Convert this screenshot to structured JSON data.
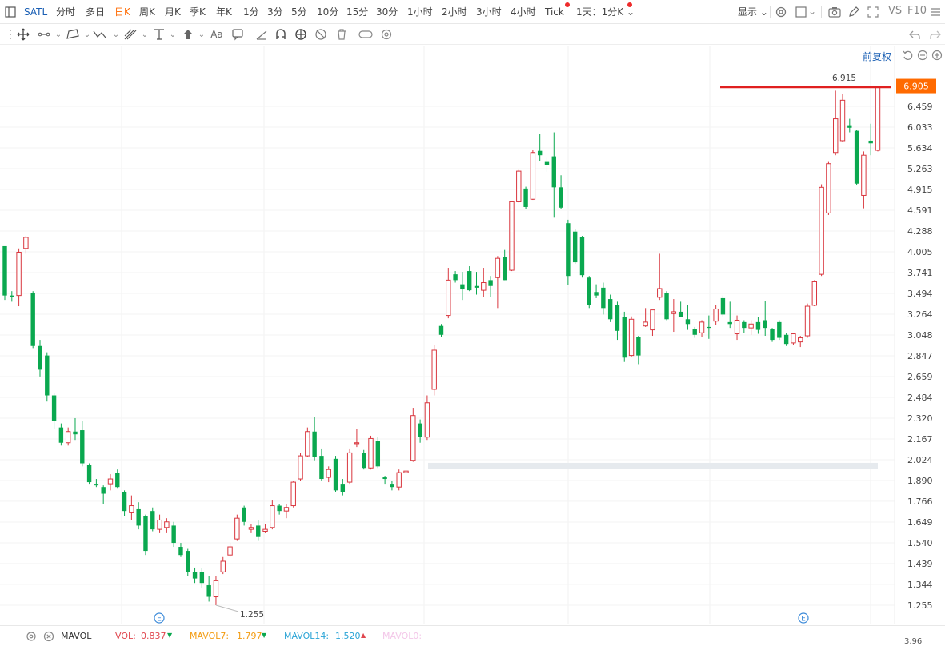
{
  "toolbar": {
    "symbol": "SATL",
    "periods": [
      "分时",
      "多日",
      "日K",
      "周K",
      "月K",
      "季K",
      "年K",
      "1分",
      "3分",
      "5分",
      "10分",
      "15分",
      "30分",
      "1小时",
      "2小时",
      "3小时",
      "4小时",
      "Tick"
    ],
    "active_period": "日K",
    "interval_selector": "1天：1分K",
    "display_label": "显示",
    "vs_label": "VS",
    "f10_label": "F10"
  },
  "chart_header": {
    "adjust_label": "前复权"
  },
  "price_axis": {
    "current_price": "6.905",
    "labels": [
      "6.459",
      "6.033",
      "5.634",
      "5.263",
      "4.915",
      "4.591",
      "4.288",
      "4.005",
      "3.741",
      "3.494",
      "3.264",
      "3.048",
      "2.847",
      "2.659",
      "2.484",
      "2.320",
      "2.167",
      "2.024",
      "1.890",
      "1.766",
      "1.649",
      "1.540",
      "1.439",
      "1.344",
      "1.255"
    ]
  },
  "annotations": {
    "high_label": "6.915",
    "low_label": "1.255",
    "event_marker": "E"
  },
  "indicator": {
    "name": "MAVOL",
    "vol_label": "VOL:",
    "vol_value": "0.837",
    "mavol7_label": "MAVOL7:",
    "mavol7_value": "1.797",
    "mavol14_label": "MAVOL14:",
    "mavol14_value": "1.520",
    "mavol0_label": "MAVOL0:",
    "axis_value": "3.96"
  },
  "colors": {
    "up": "#d9363e",
    "down": "#0aa84f",
    "accent": "#ff6a00",
    "link": "#1a5fb4"
  },
  "chart_data": {
    "type": "candlestick",
    "ylim": [
      1.255,
      6.915
    ],
    "y_scale": "log",
    "candles": [
      {
        "o": 4.08,
        "h": 4.08,
        "l": 3.42,
        "c": 3.47
      },
      {
        "o": 3.47,
        "h": 3.52,
        "l": 3.4,
        "c": 3.45
      },
      {
        "o": 3.47,
        "h": 4.05,
        "l": 3.35,
        "c": 4.0
      },
      {
        "o": 4.05,
        "h": 4.22,
        "l": 3.98,
        "c": 4.2
      },
      {
        "o": 3.5,
        "h": 3.52,
        "l": 2.92,
        "c": 2.94
      },
      {
        "o": 2.94,
        "h": 3.0,
        "l": 2.66,
        "c": 2.72
      },
      {
        "o": 2.85,
        "h": 2.88,
        "l": 2.45,
        "c": 2.5
      },
      {
        "o": 2.5,
        "h": 2.52,
        "l": 2.24,
        "c": 2.3
      },
      {
        "o": 2.25,
        "h": 2.28,
        "l": 2.12,
        "c": 2.14
      },
      {
        "o": 2.14,
        "h": 2.25,
        "l": 2.12,
        "c": 2.22
      },
      {
        "o": 2.22,
        "h": 2.32,
        "l": 2.16,
        "c": 2.2
      },
      {
        "o": 2.23,
        "h": 2.3,
        "l": 1.98,
        "c": 2.0
      },
      {
        "o": 1.99,
        "h": 2.0,
        "l": 1.87,
        "c": 1.88
      },
      {
        "o": 1.87,
        "h": 1.9,
        "l": 1.85,
        "c": 1.86
      },
      {
        "o": 1.85,
        "h": 1.86,
        "l": 1.75,
        "c": 1.81
      },
      {
        "o": 1.87,
        "h": 1.93,
        "l": 1.83,
        "c": 1.9
      },
      {
        "o": 1.94,
        "h": 1.96,
        "l": 1.84,
        "c": 1.85
      },
      {
        "o": 1.82,
        "h": 1.83,
        "l": 1.68,
        "c": 1.71
      },
      {
        "o": 1.7,
        "h": 1.8,
        "l": 1.66,
        "c": 1.74
      },
      {
        "o": 1.72,
        "h": 1.76,
        "l": 1.61,
        "c": 1.63
      },
      {
        "o": 1.68,
        "h": 1.69,
        "l": 1.48,
        "c": 1.5
      },
      {
        "o": 1.71,
        "h": 1.73,
        "l": 1.6,
        "c": 1.61
      },
      {
        "o": 1.61,
        "h": 1.69,
        "l": 1.59,
        "c": 1.66
      },
      {
        "o": 1.62,
        "h": 1.67,
        "l": 1.59,
        "c": 1.65
      },
      {
        "o": 1.63,
        "h": 1.65,
        "l": 1.52,
        "c": 1.54
      },
      {
        "o": 1.52,
        "h": 1.54,
        "l": 1.47,
        "c": 1.48
      },
      {
        "o": 1.5,
        "h": 1.51,
        "l": 1.38,
        "c": 1.4
      },
      {
        "o": 1.4,
        "h": 1.42,
        "l": 1.35,
        "c": 1.37
      },
      {
        "o": 1.4,
        "h": 1.42,
        "l": 1.33,
        "c": 1.35
      },
      {
        "o": 1.34,
        "h": 1.38,
        "l": 1.27,
        "c": 1.29
      },
      {
        "o": 1.29,
        "h": 1.38,
        "l": 1.255,
        "c": 1.36
      },
      {
        "o": 1.4,
        "h": 1.47,
        "l": 1.39,
        "c": 1.45
      },
      {
        "o": 1.48,
        "h": 1.54,
        "l": 1.47,
        "c": 1.52
      },
      {
        "o": 1.56,
        "h": 1.69,
        "l": 1.55,
        "c": 1.67
      },
      {
        "o": 1.73,
        "h": 1.74,
        "l": 1.63,
        "c": 1.65
      },
      {
        "o": 1.61,
        "h": 1.64,
        "l": 1.59,
        "c": 1.62
      },
      {
        "o": 1.63,
        "h": 1.66,
        "l": 1.55,
        "c": 1.57
      },
      {
        "o": 1.6,
        "h": 1.64,
        "l": 1.59,
        "c": 1.61
      },
      {
        "o": 1.62,
        "h": 1.77,
        "l": 1.61,
        "c": 1.74
      },
      {
        "o": 1.74,
        "h": 1.75,
        "l": 1.69,
        "c": 1.71
      },
      {
        "o": 1.71,
        "h": 1.75,
        "l": 1.67,
        "c": 1.73
      },
      {
        "o": 1.74,
        "h": 1.89,
        "l": 1.73,
        "c": 1.88
      },
      {
        "o": 1.9,
        "h": 2.07,
        "l": 1.89,
        "c": 2.05
      },
      {
        "o": 2.05,
        "h": 2.25,
        "l": 2.04,
        "c": 2.22
      },
      {
        "o": 2.22,
        "h": 2.33,
        "l": 2.02,
        "c": 2.04
      },
      {
        "o": 2.05,
        "h": 2.1,
        "l": 1.89,
        "c": 1.9
      },
      {
        "o": 1.91,
        "h": 1.98,
        "l": 1.88,
        "c": 1.96
      },
      {
        "o": 2.03,
        "h": 2.05,
        "l": 1.82,
        "c": 1.83
      },
      {
        "o": 1.87,
        "h": 1.9,
        "l": 1.8,
        "c": 1.82
      },
      {
        "o": 1.88,
        "h": 2.1,
        "l": 1.87,
        "c": 2.07
      },
      {
        "o": 2.14,
        "h": 2.24,
        "l": 2.11,
        "c": 2.14
      },
      {
        "o": 2.07,
        "h": 2.09,
        "l": 1.96,
        "c": 1.97
      },
      {
        "o": 1.97,
        "h": 2.19,
        "l": 1.96,
        "c": 2.17
      },
      {
        "o": 2.15,
        "h": 2.18,
        "l": 1.97,
        "c": 1.98
      },
      {
        "o": 1.91,
        "h": 1.92,
        "l": 1.87,
        "c": 1.9
      },
      {
        "o": 1.87,
        "h": 1.89,
        "l": 1.83,
        "c": 1.85
      },
      {
        "o": 1.85,
        "h": 1.96,
        "l": 1.83,
        "c": 1.94
      },
      {
        "o": 1.94,
        "h": 1.96,
        "l": 1.92,
        "c": 1.95
      },
      {
        "o": 2.02,
        "h": 2.4,
        "l": 2.01,
        "c": 2.34
      },
      {
        "o": 2.28,
        "h": 2.31,
        "l": 2.14,
        "c": 2.18
      },
      {
        "o": 2.18,
        "h": 2.5,
        "l": 2.16,
        "c": 2.44
      },
      {
        "o": 2.55,
        "h": 2.95,
        "l": 2.5,
        "c": 2.9
      },
      {
        "o": 3.14,
        "h": 3.16,
        "l": 3.03,
        "c": 3.05
      },
      {
        "o": 3.25,
        "h": 3.8,
        "l": 3.22,
        "c": 3.65
      },
      {
        "o": 3.72,
        "h": 3.76,
        "l": 3.62,
        "c": 3.65
      },
      {
        "o": 3.6,
        "h": 3.75,
        "l": 3.42,
        "c": 3.54
      },
      {
        "o": 3.76,
        "h": 3.82,
        "l": 3.52,
        "c": 3.53
      },
      {
        "o": 3.58,
        "h": 3.75,
        "l": 3.48,
        "c": 3.56
      },
      {
        "o": 3.53,
        "h": 3.8,
        "l": 3.45,
        "c": 3.62
      },
      {
        "o": 3.65,
        "h": 3.7,
        "l": 3.45,
        "c": 3.58
      },
      {
        "o": 3.68,
        "h": 3.95,
        "l": 3.33,
        "c": 3.92
      },
      {
        "o": 3.94,
        "h": 4.03,
        "l": 3.65,
        "c": 3.65
      },
      {
        "o": 3.77,
        "h": 4.73,
        "l": 3.76,
        "c": 4.72
      },
      {
        "o": 4.72,
        "h": 5.24,
        "l": 4.71,
        "c": 5.22
      },
      {
        "o": 4.93,
        "h": 4.96,
        "l": 4.61,
        "c": 4.64
      },
      {
        "o": 4.76,
        "h": 5.6,
        "l": 4.75,
        "c": 5.55
      },
      {
        "o": 5.58,
        "h": 5.9,
        "l": 5.4,
        "c": 5.5
      },
      {
        "o": 5.38,
        "h": 5.47,
        "l": 5.21,
        "c": 5.32
      },
      {
        "o": 5.48,
        "h": 5.93,
        "l": 4.48,
        "c": 4.95
      },
      {
        "o": 4.95,
        "h": 5.15,
        "l": 4.61,
        "c": 4.63
      },
      {
        "o": 4.4,
        "h": 4.45,
        "l": 3.59,
        "c": 3.7
      },
      {
        "o": 4.28,
        "h": 4.32,
        "l": 3.85,
        "c": 3.87
      },
      {
        "o": 4.2,
        "h": 4.22,
        "l": 3.68,
        "c": 3.71
      },
      {
        "o": 3.68,
        "h": 3.7,
        "l": 3.33,
        "c": 3.36
      },
      {
        "o": 3.51,
        "h": 3.6,
        "l": 3.44,
        "c": 3.47
      },
      {
        "o": 3.56,
        "h": 3.62,
        "l": 3.26,
        "c": 3.33
      },
      {
        "o": 3.43,
        "h": 3.48,
        "l": 3.18,
        "c": 3.21
      },
      {
        "o": 3.36,
        "h": 3.4,
        "l": 3.0,
        "c": 3.09
      },
      {
        "o": 3.23,
        "h": 3.29,
        "l": 2.79,
        "c": 2.83
      },
      {
        "o": 2.85,
        "h": 3.24,
        "l": 2.84,
        "c": 3.21
      },
      {
        "o": 3.03,
        "h": 3.04,
        "l": 2.77,
        "c": 2.85
      },
      {
        "o": 3.14,
        "h": 3.33,
        "l": 3.13,
        "c": 3.18
      },
      {
        "o": 3.1,
        "h": 3.31,
        "l": 3.04,
        "c": 3.31
      },
      {
        "o": 3.45,
        "h": 3.98,
        "l": 3.42,
        "c": 3.55
      },
      {
        "o": 3.5,
        "h": 3.52,
        "l": 3.2,
        "c": 3.21
      },
      {
        "o": 3.27,
        "h": 3.43,
        "l": 3.08,
        "c": 3.29
      },
      {
        "o": 3.29,
        "h": 3.4,
        "l": 3.26,
        "c": 3.23
      },
      {
        "o": 3.21,
        "h": 3.36,
        "l": 3.1,
        "c": 3.16
      },
      {
        "o": 3.11,
        "h": 3.13,
        "l": 3.02,
        "c": 3.05
      },
      {
        "o": 3.07,
        "h": 3.2,
        "l": 3.03,
        "c": 3.18
      },
      {
        "o": 3.13,
        "h": 3.25,
        "l": 3.01,
        "c": 3.12
      },
      {
        "o": 3.19,
        "h": 3.36,
        "l": 3.15,
        "c": 3.32
      },
      {
        "o": 3.44,
        "h": 3.47,
        "l": 3.24,
        "c": 3.26
      },
      {
        "o": 3.18,
        "h": 3.4,
        "l": 3.12,
        "c": 3.16
      },
      {
        "o": 3.06,
        "h": 3.25,
        "l": 3.0,
        "c": 3.2
      },
      {
        "o": 3.18,
        "h": 3.2,
        "l": 3.07,
        "c": 3.12
      },
      {
        "o": 3.12,
        "h": 3.2,
        "l": 3.05,
        "c": 3.16
      },
      {
        "o": 3.18,
        "h": 3.23,
        "l": 3.06,
        "c": 3.1
      },
      {
        "o": 3.2,
        "h": 3.41,
        "l": 3.04,
        "c": 3.12
      },
      {
        "o": 3.11,
        "h": 3.12,
        "l": 2.98,
        "c": 3.0
      },
      {
        "o": 3.18,
        "h": 3.2,
        "l": 3.0,
        "c": 3.02
      },
      {
        "o": 3.05,
        "h": 3.07,
        "l": 2.94,
        "c": 2.96
      },
      {
        "o": 2.97,
        "h": 3.07,
        "l": 2.95,
        "c": 3.06
      },
      {
        "o": 2.98,
        "h": 3.04,
        "l": 2.93,
        "c": 3.02
      },
      {
        "o": 3.04,
        "h": 3.38,
        "l": 3.02,
        "c": 3.35
      },
      {
        "o": 3.36,
        "h": 3.65,
        "l": 3.35,
        "c": 3.63
      },
      {
        "o": 3.72,
        "h": 5.0,
        "l": 3.7,
        "c": 4.95
      },
      {
        "o": 4.55,
        "h": 5.38,
        "l": 4.52,
        "c": 5.35
      },
      {
        "o": 5.55,
        "h": 6.8,
        "l": 5.5,
        "c": 6.2
      },
      {
        "o": 5.77,
        "h": 6.72,
        "l": 5.75,
        "c": 6.59
      },
      {
        "o": 6.07,
        "h": 6.2,
        "l": 5.93,
        "c": 6.02
      },
      {
        "o": 5.96,
        "h": 5.97,
        "l": 4.98,
        "c": 5.01
      },
      {
        "o": 4.82,
        "h": 5.57,
        "l": 4.62,
        "c": 5.5
      },
      {
        "o": 5.77,
        "h": 6.1,
        "l": 5.5,
        "c": 5.72
      },
      {
        "o": 5.59,
        "h": 6.915,
        "l": 5.57,
        "c": 6.905
      }
    ]
  }
}
